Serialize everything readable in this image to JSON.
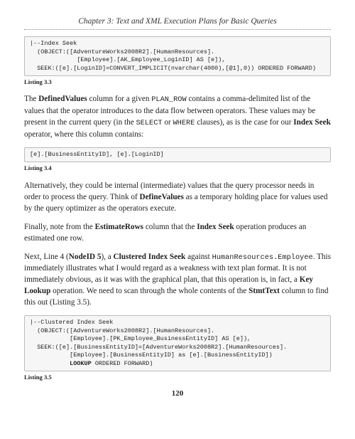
{
  "chapter": "Chapter 3: Text and XML Execution Plans for Basic Queries",
  "code1": "|--Index Seek\n  (OBJECT:([AdventureWorks2008R2].[HumanResources].\n             [Employee].[AK_Employee_LoginID] AS [e]),\n  SEEK:([e].[LoginID]=CONVERT_IMPLICIT(nvarchar(4000),[@1],0)) ORDERED FORWARD)",
  "listing1": "Listing 3.3",
  "p1a": "The ",
  "p1b": "DefinedValues",
  "p1c": " column for a given ",
  "p1d": "PLAN_ROW",
  "p1e": " contains a comma-delimited list of the values that the operator introduces to the data flow between operators. These values may be present in the current query (in the ",
  "p1f": "SELECT",
  "p1g": " or ",
  "p1h": "WHERE",
  "p1i": " clauses), as is the case for our ",
  "p1j": "Index Seek",
  "p1k": " operator, where this column contains:",
  "code2": "[e].[BusinessEntityID], [e].[LoginID]",
  "listing2": "Listing 3.4",
  "p2a": "Alternatively, they could be internal (intermediate) values that the query processor needs in order to process the query. Think of ",
  "p2b": "DefineValues",
  "p2c": " as a temporary holding place for values used by the query optimizer as the operators execute.",
  "p3a": "Finally, note from the ",
  "p3b": "EstimateRows",
  "p3c": " column that the ",
  "p3d": "Index Seek",
  "p3e": " operation produces an estimated one row.",
  "p4a": "Next, Line 4 (",
  "p4b": "NodeID 5",
  "p4c": "), a ",
  "p4d": "Clustered Index Seek",
  "p4e": " against ",
  "p4f": "HumanResources.Employee",
  "p4g": ". This immediately illustrates what I would regard as a weakness with text plan format. It is not immediately obvious, as it was with the graphical plan, that this operation is, in fact, a ",
  "p4h": "Key Lookup",
  "p4i": " operation. We need to scan through the whole contents of the ",
  "p4j": "StmtText",
  "p4k": " column to find this out (Listing 3.5).",
  "code3a": "|--Clustered Index Seek\n  (OBJECT:([AdventureWorks2008R2].[HumanResources].\n           [Employee].[PK_Employee_BusinessEntityID] AS [e]),\n  SEEK:([e].[BusinessEntityID]=[AdventureWorks2008R2].[HumanResources].\n           [Employee].[BusinessEntityID] as [e].[BusinessEntityID])\n           ",
  "code3b": "LOOKUP",
  "code3c": " ORDERED FORWARD)",
  "listing3": "Listing 3.5",
  "pagenum": "120"
}
